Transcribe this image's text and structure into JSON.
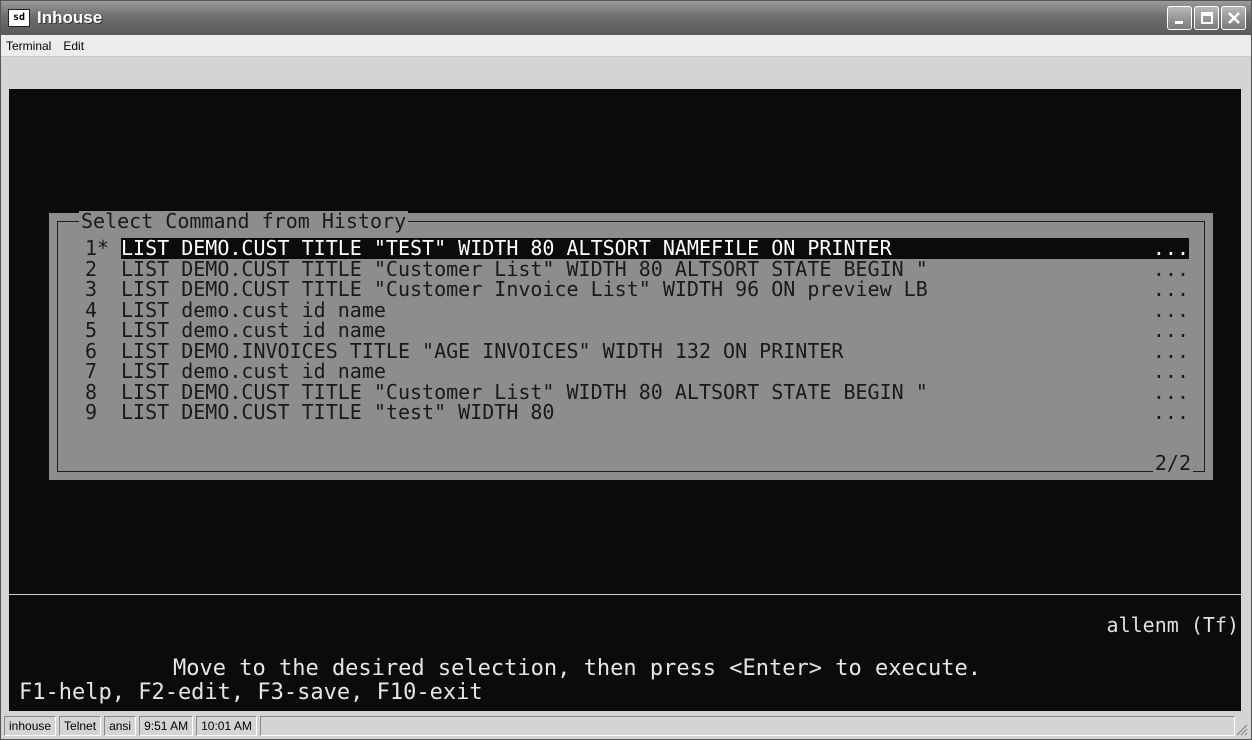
{
  "window": {
    "title": "Inhouse",
    "icon_label": "sd"
  },
  "menu": {
    "items": [
      "Terminal",
      "Edit"
    ]
  },
  "dialog": {
    "title": "Select Command from History",
    "page": "2/2",
    "rows": [
      {
        "num": "1*",
        "cmd": "LIST DEMO.CUST TITLE \"TEST\" WIDTH 80 ALTSORT NAMEFILE ON PRINTER",
        "more": "...",
        "selected": true
      },
      {
        "num": "2",
        "cmd": "LIST DEMO.CUST TITLE \"Customer List\" WIDTH 80 ALTSORT STATE BEGIN \"",
        "more": "...",
        "selected": false
      },
      {
        "num": "3",
        "cmd": "LIST DEMO.CUST TITLE \"Customer Invoice List\" WIDTH 96 ON preview LB",
        "more": "...",
        "selected": false
      },
      {
        "num": "4",
        "cmd": "LIST demo.cust id name",
        "more": "...",
        "selected": false
      },
      {
        "num": "5",
        "cmd": "LIST demo.cust id name",
        "more": "...",
        "selected": false
      },
      {
        "num": "6",
        "cmd": "LIST DEMO.INVOICES TITLE \"AGE INVOICES\" WIDTH 132 ON PRINTER",
        "more": "...",
        "selected": false
      },
      {
        "num": "7",
        "cmd": "LIST demo.cust id name",
        "more": "...",
        "selected": false
      },
      {
        "num": "8",
        "cmd": "LIST DEMO.CUST TITLE \"Customer List\" WIDTH 80 ALTSORT STATE BEGIN \"",
        "more": "...",
        "selected": false
      },
      {
        "num": "9",
        "cmd": "LIST DEMO.CUST TITLE \"test\" WIDTH 80",
        "more": "...",
        "selected": false
      }
    ]
  },
  "terminal": {
    "user_status": "allenm (Tf)",
    "prompt": "Move to the desired selection, then press <Enter> to execute.",
    "keys": "F1-help, F2-edit, F3-save, F10-exit"
  },
  "statusbar": {
    "cells": [
      "inhouse",
      "Telnet",
      "ansi",
      "9:51 AM",
      "10:01 AM"
    ]
  }
}
